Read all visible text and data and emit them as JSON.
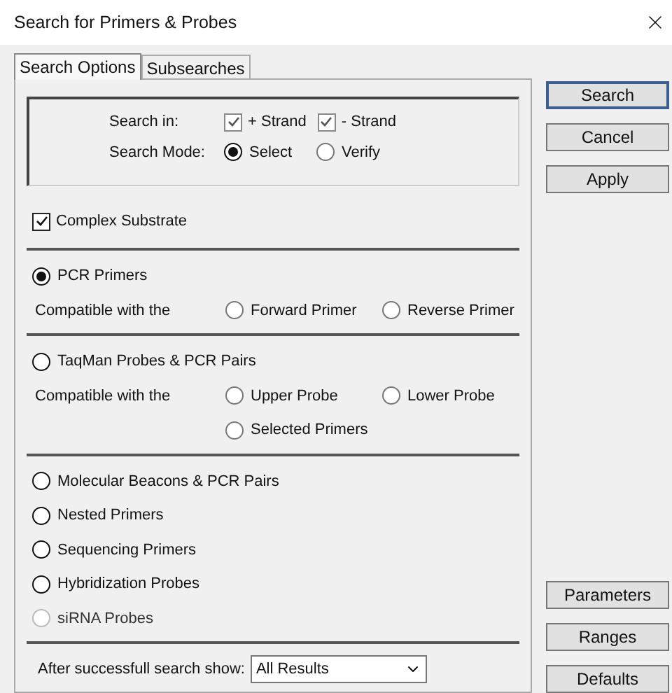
{
  "window": {
    "title": "Search for Primers & Probes"
  },
  "tabs": [
    {
      "label": "Search Options",
      "selected": true
    },
    {
      "label": "Subsearches",
      "selected": false
    }
  ],
  "search_in": {
    "label": "Search in:",
    "options": [
      {
        "label": "+ Strand",
        "checked": true
      },
      {
        "label": "- Strand",
        "checked": true
      }
    ]
  },
  "search_mode": {
    "label": "Search Mode:",
    "options": [
      {
        "label": "Select",
        "selected": true
      },
      {
        "label": "Verify",
        "selected": false
      }
    ]
  },
  "complex_substrate": {
    "label": "Complex Substrate",
    "checked": true
  },
  "groups": [
    {
      "types": [
        {
          "label": "PCR Primers",
          "selected": true,
          "disabled": false
        }
      ],
      "compatible": {
        "label": "Compatible with the",
        "options": [
          {
            "label": "Forward Primer",
            "selected": false
          },
          {
            "label": "Reverse Primer",
            "selected": false
          }
        ]
      }
    },
    {
      "types": [
        {
          "label": "TaqMan Probes & PCR Pairs",
          "selected": false,
          "disabled": false
        }
      ],
      "compatible": {
        "label": "Compatible with the",
        "options": [
          {
            "label": "Upper Probe",
            "selected": false
          },
          {
            "label": "Lower Probe",
            "selected": false
          },
          {
            "label": "Selected Primers",
            "selected": false
          }
        ]
      }
    },
    {
      "types": [
        {
          "label": "Molecular Beacons & PCR Pairs",
          "selected": false,
          "disabled": false
        },
        {
          "label": "Nested Primers",
          "selected": false,
          "disabled": false
        },
        {
          "label": "Sequencing Primers",
          "selected": false,
          "disabled": false
        },
        {
          "label": "Hybridization Probes",
          "selected": false,
          "disabled": false
        },
        {
          "label": "siRNA Probes",
          "selected": false,
          "disabled": true
        }
      ]
    }
  ],
  "after_search": {
    "label": "After successfull search show:",
    "value": "All Results"
  },
  "buttons_top": [
    {
      "label": "Search",
      "default": true
    },
    {
      "label": "Cancel",
      "default": false
    },
    {
      "label": "Apply",
      "default": false
    }
  ],
  "buttons_bottom": [
    {
      "label": "Parameters",
      "default": false
    },
    {
      "label": "Ranges",
      "default": false
    },
    {
      "label": "Defaults",
      "default": false
    }
  ]
}
